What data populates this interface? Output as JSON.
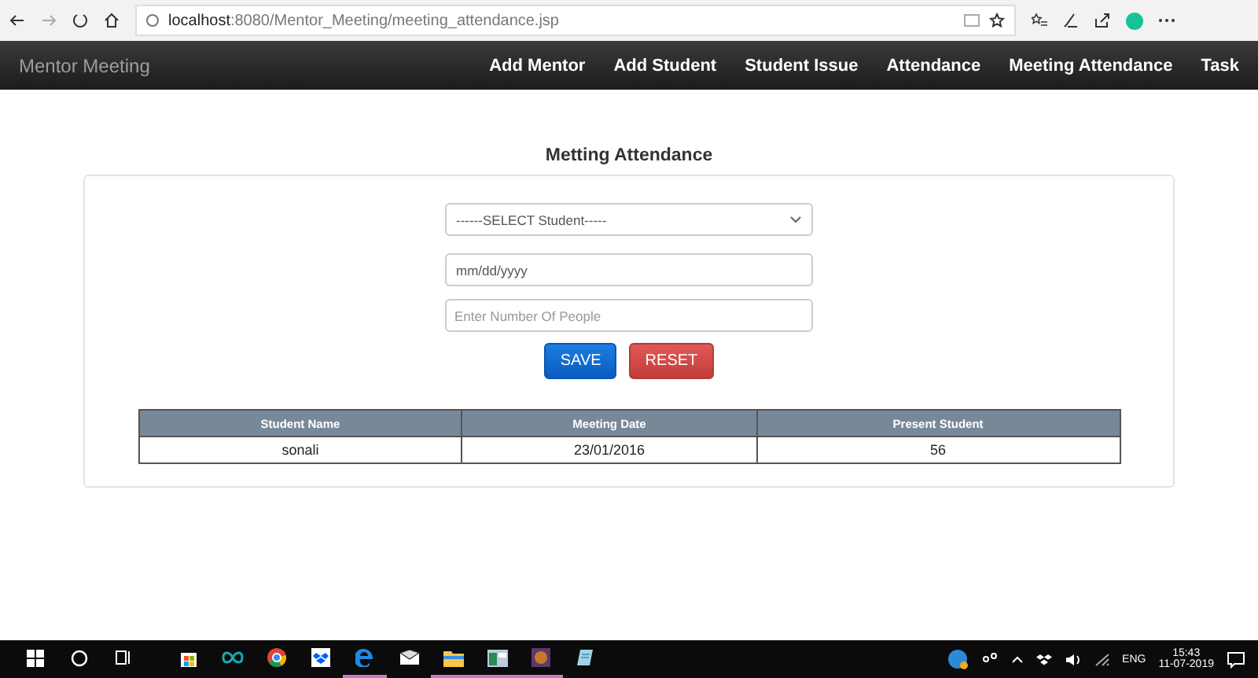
{
  "browser": {
    "url_host": "localhost",
    "url_path": ":8080/Mentor_Meeting/meeting_attendance.jsp"
  },
  "navbar": {
    "brand": "Mentor Meeting",
    "links": [
      "Add Mentor",
      "Add Student",
      "Student Issue",
      "Attendance",
      "Meeting Attendance",
      "Task"
    ]
  },
  "form": {
    "title": "Metting Attendance",
    "student_select": "------SELECT Student-----",
    "date_field": "mm/dd/yyyy",
    "people_field": {
      "placeholder": "Enter Number Of People"
    },
    "buttons": [
      {
        "label": "SAVE",
        "kind": "primary"
      },
      {
        "label": "RESET",
        "kind": "danger"
      }
    ]
  },
  "table": {
    "columns": [
      "Student Name",
      "Meeting Date",
      "Present Student"
    ],
    "rows": [
      [
        "sonali",
        "23/01/2016",
        "56"
      ]
    ]
  },
  "taskbar": {
    "apps": [
      {
        "kind": "store",
        "running": false
      },
      {
        "kind": "infinity",
        "running": false
      },
      {
        "kind": "chrome",
        "running": false
      },
      {
        "kind": "dropbox",
        "running": false
      },
      {
        "kind": "edge",
        "running": true
      },
      {
        "kind": "mail",
        "running": false
      },
      {
        "kind": "folder",
        "running": true
      },
      {
        "kind": "window",
        "running": true
      },
      {
        "kind": "game",
        "running": true
      },
      {
        "kind": "notepad",
        "running": false
      }
    ],
    "language": "ENG",
    "time": "15:43",
    "date": "11-07-2019"
  }
}
